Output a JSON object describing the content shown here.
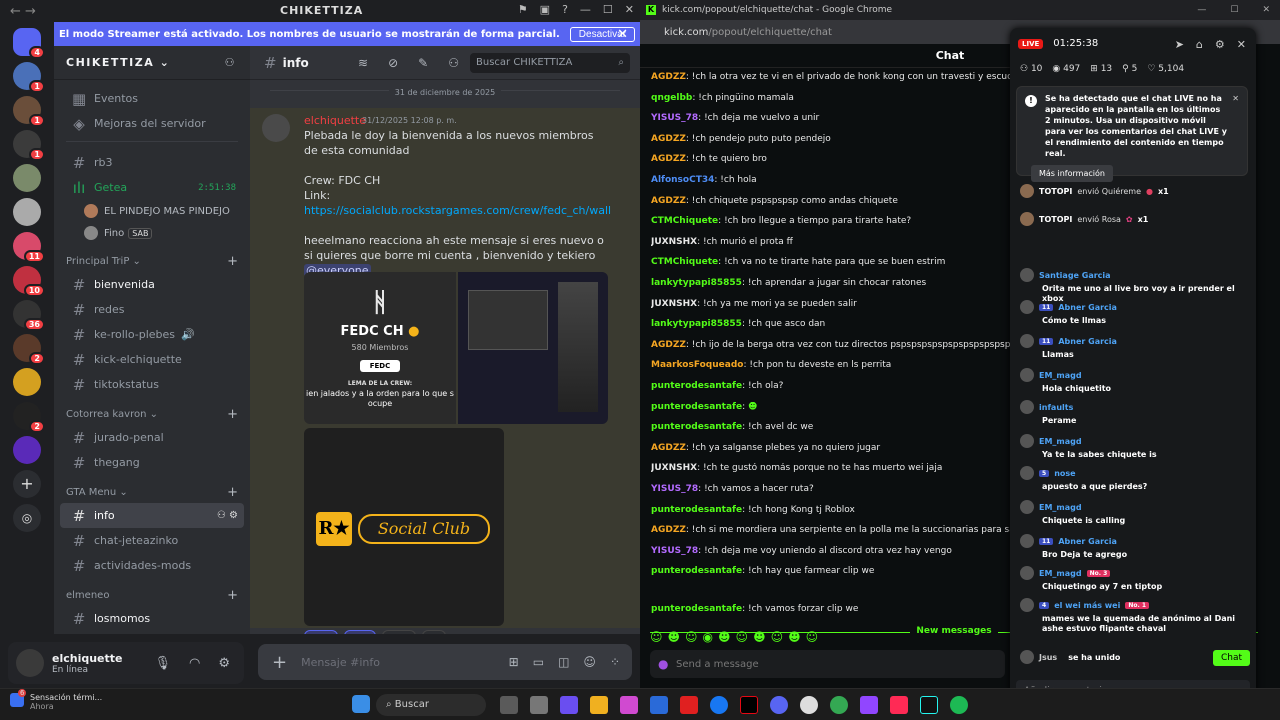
{
  "discord": {
    "title": "CHIKETTIZA",
    "banner": {
      "text": "El modo Streamer está activado. Los nombres de usuario se mostrarán de forma parcial.",
      "button": "Desactivar"
    },
    "server_name": "CHIKETTIZA",
    "top_items": [
      {
        "label": "Eventos"
      },
      {
        "label": "Mejoras del servidor"
      }
    ],
    "channels_a": [
      {
        "label": "rb3"
      }
    ],
    "voice": {
      "label": "Getea",
      "time": "2:51:38",
      "users": [
        {
          "name": "EL PINDEJO MAS PINDEJO"
        },
        {
          "name": "Fino",
          "badge": "SAB"
        }
      ]
    },
    "categories": [
      {
        "label": "Principal TriP",
        "channels": [
          "bienvenida",
          "redes",
          "ke-rollo-plebes",
          "kick-elchiquette",
          "tiktokstatus"
        ]
      },
      {
        "label": "Cotorrea kavron",
        "channels": [
          "jurado-penal",
          "thegang"
        ]
      },
      {
        "label": "GTA Menu",
        "channels": [
          "info",
          "chat-jeteazinko",
          "actividades-mods"
        ]
      },
      {
        "label": "elmeneo",
        "channels": [
          "losmomos"
        ]
      }
    ],
    "user": {
      "name": "elchiquette",
      "status": "En línea"
    },
    "channel_header": {
      "name": "info",
      "search_placeholder": "Buscar CHIKETTIZA"
    },
    "date_separator": "31 de diciembre de 2025",
    "message": {
      "author": "elchiquette",
      "time": "31/12/2025 12:08 p. m.",
      "line1": "Plebada le doy la bienvenida a los nuevos miembros de esta comunidad",
      "crew": "Crew: FDC CH",
      "link_label": "Link:",
      "link": "https://socialclub.rockstargames.com/crew/fedc_ch/wall",
      "line3": "heeelmano reacciona ah este mensaje si eres nuevo o si quieres que borre mi cuenta , bienvenido y tekiero",
      "mention": "@everyone"
    },
    "crew_card": {
      "name": "FEDC CH",
      "members": "580 Miembros",
      "tag": "FEDC",
      "lema": "LEMA DE LA CREW:",
      "lema_text": "ien jalados y a la orden para lo que s ocupe"
    },
    "social_club": "Social Club",
    "reactions": [
      {
        "count": "1"
      },
      {
        "count": "1"
      },
      {
        "count": "1"
      }
    ],
    "composer_placeholder": "Mensaje #info"
  },
  "chrome": {
    "title": "kick.com/popout/elchiquette/chat - Google Chrome",
    "url_host": "kick.com",
    "url_path": "/popout/elchiquette/chat",
    "chat_header": "Chat",
    "messages": [
      {
        "user": "AGDZZ",
        "color": "#f5a623",
        "text": "!ch la otra vez te vi en el privado de honk kong con un travesti y escuche que dijo que te gusto"
      },
      {
        "user": "qngelbb",
        "color": "#53fc18",
        "text": "!ch pingüino mamala"
      },
      {
        "user": "YISUS_78",
        "color": "#b36bff",
        "text": "!ch deja me vuelvo a unir"
      },
      {
        "user": "AGDZZ",
        "color": "#f5a623",
        "text": "!ch pendejo puto puto pendejo"
      },
      {
        "user": "AGDZZ",
        "color": "#f5a623",
        "text": "!ch te quiero bro"
      },
      {
        "user": "AlfonsoCT34",
        "color": "#4e8df5",
        "text": "!ch hola"
      },
      {
        "user": "AGDZZ",
        "color": "#f5a623",
        "text": "!ch chiquete pspspspsp como andas chiquete"
      },
      {
        "user": "CTMChiquete",
        "color": "#53fc18",
        "text": "!ch bro llegue a tiempo para tirarte hate?"
      },
      {
        "user": "JUXNSHX",
        "color": "#e8e8e8",
        "text": "!ch murió el prota ff"
      },
      {
        "user": "CTMChiquete",
        "color": "#53fc18",
        "text": "!ch va no te tirarte hate para que se buen estrim"
      },
      {
        "user": "lankytypapi85855",
        "color": "#53fc18",
        "text": "!ch aprendar a jugar sin chocar ratones"
      },
      {
        "user": "JUXNSHX",
        "color": "#e8e8e8",
        "text": "!ch ya me mori ya se pueden salir"
      },
      {
        "user": "lankytypapi85855",
        "color": "#53fc18",
        "text": "!ch que asco dan"
      },
      {
        "user": "AGDZZ",
        "color": "#f5a623",
        "text": "!ch ijo de la berga otra vez con tuz directos pspspspspspspspspspspspsp vas t"
      },
      {
        "user": "MaarkosFoqueado",
        "color": "#f5a623",
        "text": "!ch pon tu deveste en ls perrita"
      },
      {
        "user": "punterodesantafe",
        "color": "#53fc18",
        "text": "!ch ola?"
      },
      {
        "user": "punterodesantafe",
        "color": "#53fc18",
        "text": ""
      },
      {
        "user": "punterodesantafe",
        "color": "#53fc18",
        "text": "!ch avel dc we"
      },
      {
        "user": "AGDZZ",
        "color": "#f5a623",
        "text": "!ch ya salganse plebes ya no quiero jugar"
      },
      {
        "user": "JUXNSHX",
        "color": "#e8e8e8",
        "text": "!ch te gustó nomás porque no te has muerto wei jaja"
      },
      {
        "user": "YISUS_78",
        "color": "#b36bff",
        "text": "!ch vamos a hacer ruta?"
      },
      {
        "user": "punterodesantafe",
        "color": "#53fc18",
        "text": "!ch hong Kong tj Roblox"
      },
      {
        "user": "AGDZZ",
        "color": "#f5a623",
        "text": "!ch si me mordiera una serpiente en la polla me la succionarias para sacarme el veneno bro? pspspsps"
      },
      {
        "user": "YISUS_78",
        "color": "#b36bff",
        "text": "!ch deja me voy uniendo al discord otra vez hay vengo"
      },
      {
        "user": "punterodesantafe",
        "color": "#53fc18",
        "text": "!ch hay que farmear clip we"
      }
    ],
    "new_messages": "New messages",
    "after_new": {
      "user": "punterodesantafe",
      "color": "#53fc18",
      "text": "!ch vamos forzar clip we"
    },
    "send_placeholder": "Send a message"
  },
  "live": {
    "badge": "LIVE",
    "timer": "01:25:38",
    "stats": [
      "10",
      "497",
      "13",
      "5",
      "5,104"
    ],
    "alert": "Se ha detectado que el chat LIVE no ha aparecido en la pantalla en los últimos 2 minutos. Usa un dispositivo móvil para ver los comentarios del chat LIVE y el rendimiento del contenido en tiempo real.",
    "more_info": "Más información",
    "gifts": [
      {
        "user": "TOTOPI",
        "text": "envió Quiéreme",
        "count": "x1"
      },
      {
        "user": "TOTOPI",
        "text": "envió Rosa",
        "count": "x1"
      }
    ],
    "comments": [
      {
        "user": "Santiage Garcia",
        "level": "",
        "text": "Orita me uno al live bro voy a ir prender el xbox"
      },
      {
        "user": "Abner Garcia",
        "level": "11",
        "text": "Cómo te llmas"
      },
      {
        "user": "Abner Garcia",
        "level": "11",
        "text": "Llamas"
      },
      {
        "user": "EM_magd",
        "level": "",
        "text": "Hola chiquetito"
      },
      {
        "user": "infaults",
        "level": "",
        "text": "Perame"
      },
      {
        "user": "EM_magd",
        "level": "",
        "text": "Ya te la sabes chiquete is"
      },
      {
        "user": "nose",
        "level": "5",
        "text": "apuesto a que pierdes?"
      },
      {
        "user": "EM_magd",
        "level": "",
        "text": "Chiquete is calling"
      },
      {
        "user": "Abner Garcia",
        "level": "11",
        "text": "Bro Deja te agrego"
      },
      {
        "user": "EM_magd",
        "level": "",
        "badge": "No. 3",
        "text": "Chiquetingo ay 7 en tiptop"
      },
      {
        "user": "el wei más wei",
        "level": "4",
        "badge": "No. 1",
        "text": "mames we la quemada de anónimo al Dani ashe estuvo flipante chaval"
      },
      {
        "user": "Jsus",
        "level": "",
        "text": "se ha unido"
      }
    ],
    "chat_button": "Chat",
    "comment_placeholder": "Añadir comentario"
  },
  "taskbar": {
    "notif_title": "Sensación térmi...",
    "notif_sub": "Ahora",
    "notif_badge": "6",
    "search": "Buscar"
  },
  "colors": {
    "blurple": "#5865f2",
    "kick_green": "#53fc18",
    "mention_red": "#f23f43"
  }
}
